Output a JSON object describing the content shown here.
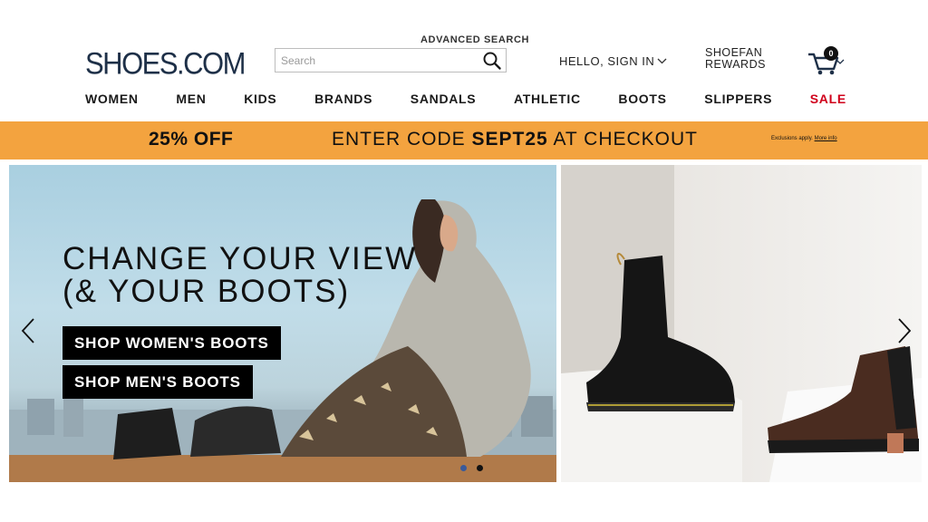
{
  "header": {
    "logo": "SHOES.COM",
    "advanced_search": "ADVANCED SEARCH",
    "search_placeholder": "Search",
    "signin": "HELLO, SIGN IN",
    "rewards_line1": "SHOEFAN",
    "rewards_line2": "REWARDS",
    "cart_count": "0"
  },
  "nav": {
    "items": [
      "WOMEN",
      "MEN",
      "KIDS",
      "BRANDS",
      "SANDALS",
      "ATHLETIC",
      "BOOTS",
      "SLIPPERS",
      "SALE"
    ]
  },
  "promo": {
    "discount": "25% OFF",
    "code_prefix": "ENTER CODE",
    "code": "SEPT25",
    "code_suffix": "AT CHECKOUT",
    "fine_print": "Exclusions apply.",
    "more_info": "More info"
  },
  "hero": {
    "headline_line1": "CHANGE YOUR VIEW",
    "headline_line2": "(& YOUR BOOTS)",
    "cta_women": "SHOP WOMEN'S BOOTS",
    "cta_men": "SHOP MEN'S BOOTS",
    "carousel_active_slide": 2,
    "carousel_total_slides": 2
  },
  "colors": {
    "promo_bg": "#f3a33f",
    "sale": "#d0021b",
    "logo": "#1e3048"
  },
  "icons": [
    "search-icon",
    "chevron-down-icon",
    "cart-icon",
    "arrow-left-icon",
    "arrow-right-icon"
  ]
}
